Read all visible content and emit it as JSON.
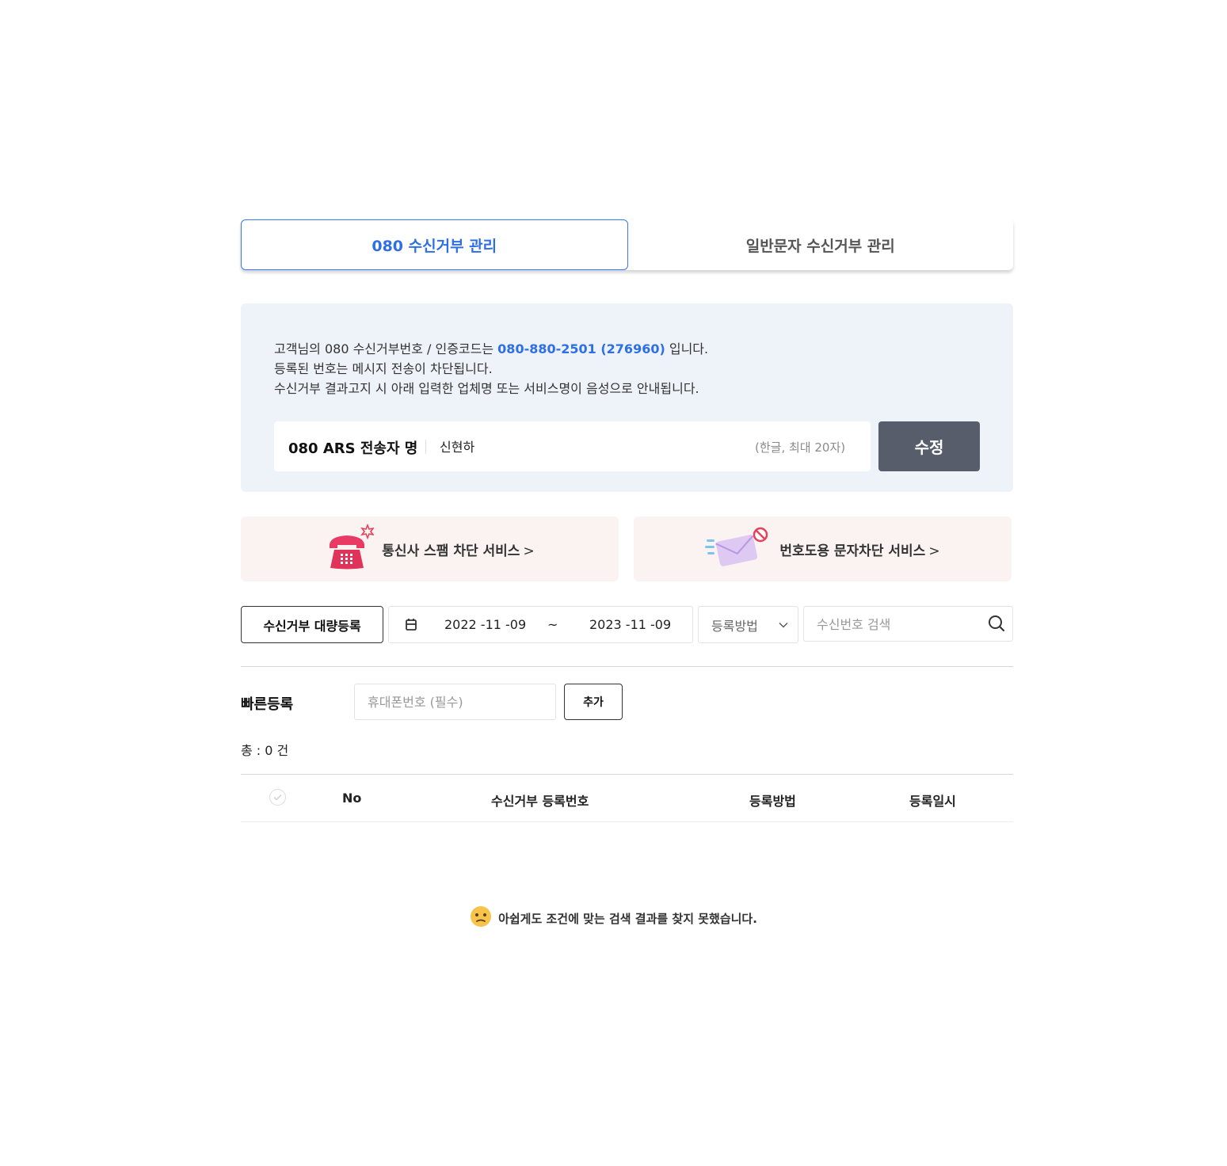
{
  "tabs": [
    {
      "label": "080 수신거부 관리",
      "active": true
    },
    {
      "label": "일반문자 수신거부 관리",
      "active": false
    }
  ],
  "info": {
    "line1_prefix": "고객님의 080 수신거부번호 / 인증코드는 ",
    "line1_highlight": "080-880-2501 (276960)",
    "line1_suffix": " 입니다.",
    "line2": "등록된 번호는 메시지 전송이 차단됩니다.",
    "line3": "수신거부 결과고지 시 아래 입력한 업체명 또는 서비스명이 음성으로 안내됩니다."
  },
  "ars": {
    "label": "080 ARS 전송자 명",
    "value": "신현하",
    "hint": "(한글, 최대 20자)",
    "edit_label": "수정"
  },
  "banners": [
    {
      "label": "통신사 스팸 차단 서비스",
      "chevron": ">",
      "icon": "telephone-icon"
    },
    {
      "label": "번호도용 문자차단 서비스",
      "chevron": ">",
      "icon": "blocked-mail-icon"
    }
  ],
  "filters": {
    "bulk_label": "수신거부 대량등록",
    "date_from": "2022 -11 -09",
    "date_sep": "~",
    "date_to": "2023 -11 -09",
    "method_label": "등록방법",
    "search_placeholder": "수신번호 검색"
  },
  "quick": {
    "label": "빠른등록",
    "placeholder": "휴대폰번호 (필수)",
    "add_label": "추가"
  },
  "total": "총 : 0 건",
  "table": {
    "headers": [
      "No",
      "수신거부 등록번호",
      "등록방법",
      "등록일시"
    ],
    "rows": []
  },
  "empty_message": "아쉽게도 조건에 맞는 검색 결과를 찾지 못했습니다.",
  "colors": {
    "accent": "#2f6fe6",
    "edit_button": "#585d6b",
    "info_bg": "#eef2f9",
    "banner_bg": "#fbf3f1"
  }
}
